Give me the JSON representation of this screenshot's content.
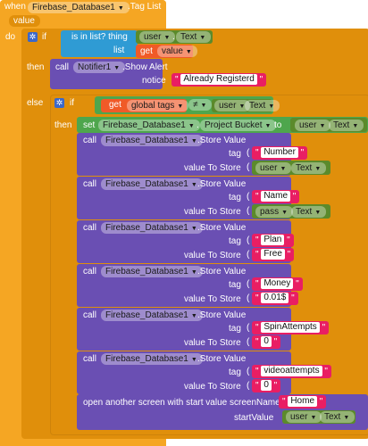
{
  "event": {
    "when": "when",
    "component": "Firebase_Database1",
    "event_name": ".Tag List",
    "param": "value",
    "do": "do"
  },
  "if1": {
    "if": "if",
    "is_in_list": "is in list? thing",
    "list": "list",
    "then": "then",
    "else": "else",
    "thing_comp": "user",
    "thing_prop": "Text",
    "get": "get",
    "get_var": "value"
  },
  "alert": {
    "call": "call",
    "component": "Notifier1",
    "method": ".Show Alert",
    "notice": "notice",
    "text": "Already Registerd"
  },
  "if2": {
    "if": "if",
    "then": "then",
    "get": "get",
    "var": "global tags",
    "op": "≠",
    "comp": "user",
    "prop": "Text"
  },
  "setblock": {
    "set": "set",
    "component": "Firebase_Database1",
    "prop": "Project Bucket",
    "to": "to",
    "val_comp": "user",
    "val_prop": "Text"
  },
  "labels": {
    "call": "call",
    "method": ".Store Value",
    "tag": "tag",
    "value_to_store": "value To Store"
  },
  "store_calls": [
    {
      "component": "Firebase_Database1",
      "tag": "Number",
      "value_comp": "user",
      "value_prop": "Text"
    },
    {
      "component": "Firebase_Database1",
      "tag": "Name",
      "value_comp": "pass",
      "value_prop": "Text"
    },
    {
      "component": "Firebase_Database1",
      "tag": "Plan",
      "value_text": "Free"
    },
    {
      "component": "Firebase_Database1",
      "tag": "Money",
      "value_text": "0.01$"
    },
    {
      "component": "Firebase_Database1",
      "tag": "SpinAttempts",
      "value_text": "0"
    },
    {
      "component": "Firebase_Database1",
      "tag": "videoattempts",
      "value_text": "0"
    }
  ],
  "open_screen": {
    "label": "open another screen with start value  screenName",
    "screen": "Home",
    "start_value": "startValue",
    "comp": "user",
    "prop": "Text"
  },
  "colors": {
    "event": "#f5a623",
    "control": "#e08f0b",
    "call": "#6a4fb3",
    "set": "#4ea64d",
    "text": "#e91e63",
    "logic": "#2f9bd4",
    "variable": "#f05a28"
  }
}
